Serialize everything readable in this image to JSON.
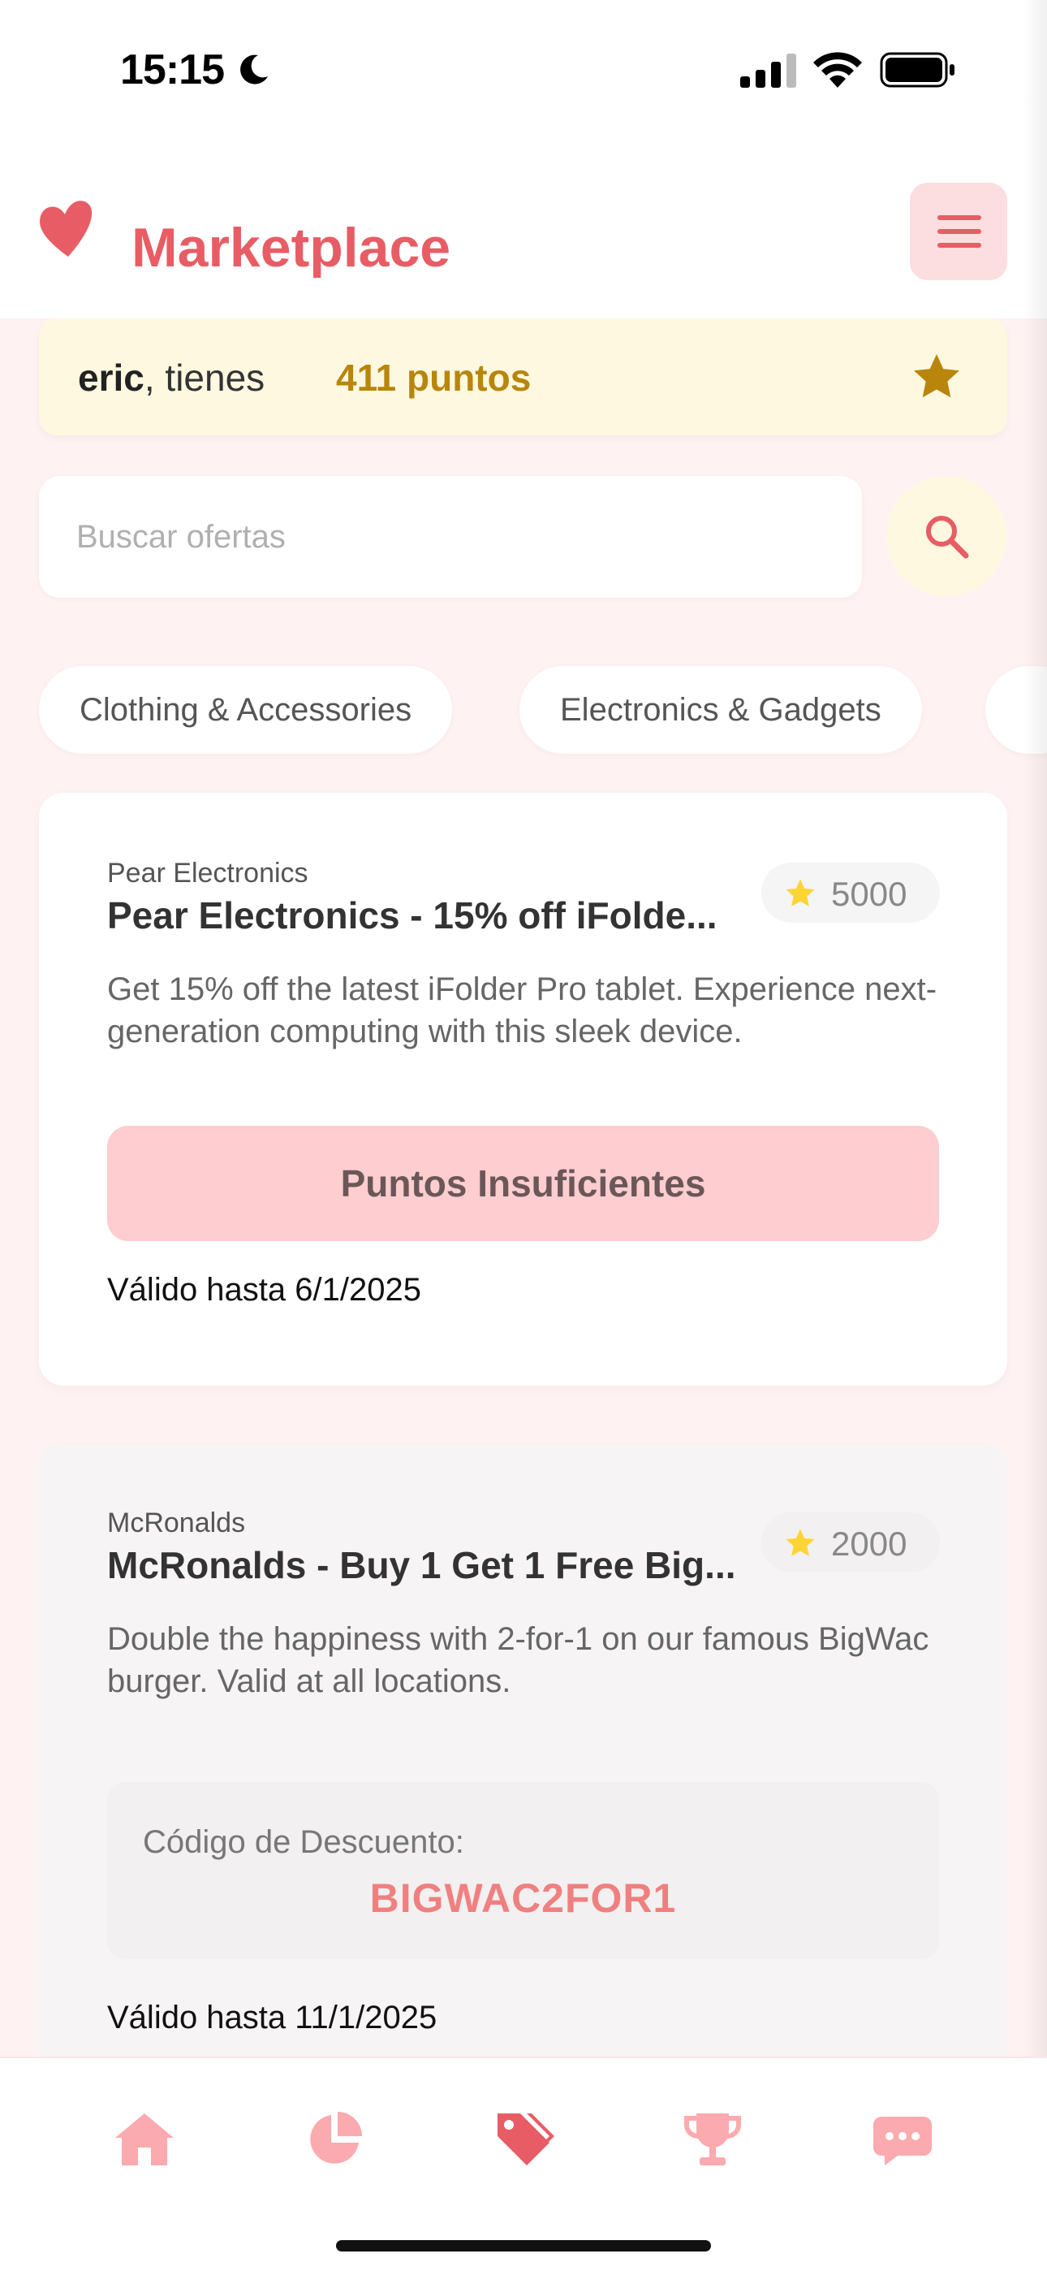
{
  "status_bar": {
    "time": "15:15"
  },
  "header": {
    "title": "Marketplace"
  },
  "points_banner": {
    "username": "eric",
    "text": ", tienes",
    "points": "411 puntos"
  },
  "search": {
    "placeholder": "Buscar ofertas"
  },
  "categories": [
    "Clothing & Accessories",
    "Electronics & Gadgets"
  ],
  "offers": [
    {
      "merchant": "Pear Electronics",
      "title": "Pear Electronics - 15% off iFolde...",
      "description": "Get 15% off the latest iFolder Pro tablet. Experience next-generation computing with this sleek device.",
      "cost": "5000",
      "action_label": "Puntos Insuficientes",
      "valid": "Válido hasta 6/1/2025"
    },
    {
      "merchant": "McRonalds",
      "title": "McRonalds - Buy 1 Get 1 Free Big...",
      "description": "Double the happiness with 2-for-1 on our famous BigWac burger. Valid at all locations.",
      "cost": "2000",
      "code_label": "Código de Descuento:",
      "code": "BIGWAC2FOR1",
      "valid": "Válido hasta 11/1/2025"
    }
  ],
  "tabbar": {
    "items": [
      {
        "icon": "home-icon"
      },
      {
        "icon": "pie-chart-icon"
      },
      {
        "icon": "tags-icon",
        "active": true
      },
      {
        "icon": "trophy-icon"
      },
      {
        "icon": "chat-icon"
      }
    ]
  },
  "colors": {
    "accent": "#e85d65",
    "gold": "#b8860b",
    "background": "#fff2f2",
    "tab_inactive": "#fbaaaf"
  }
}
